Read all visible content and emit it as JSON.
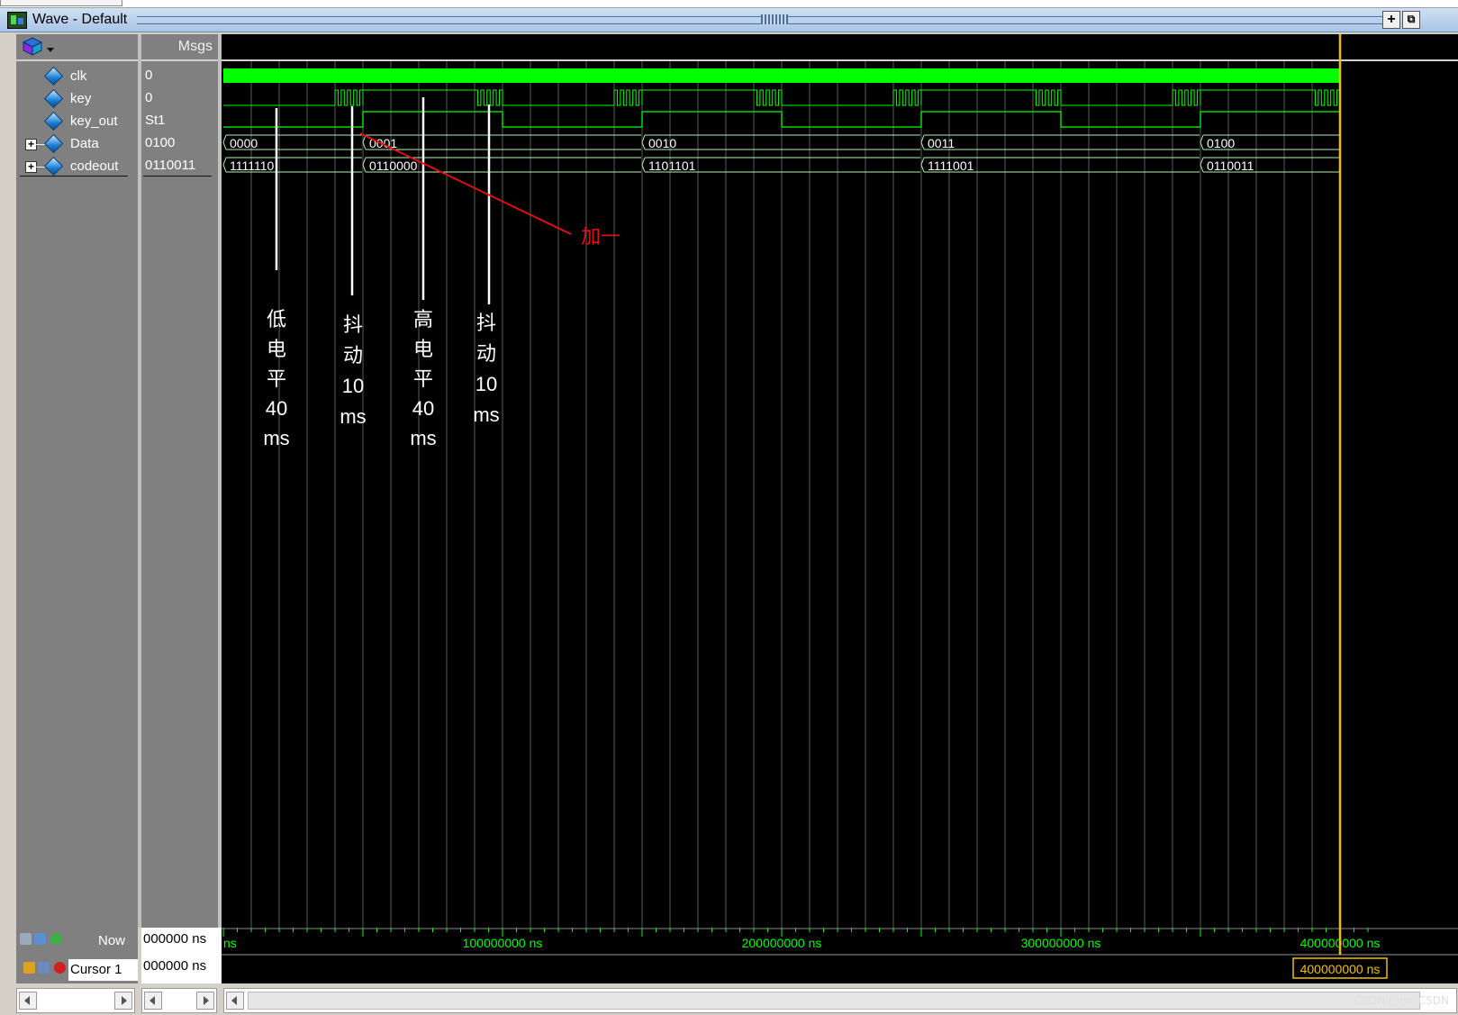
{
  "window": {
    "title": "Wave - Default",
    "add_button": "+",
    "undock_button": "⧉"
  },
  "names_pane": {
    "signals": [
      {
        "label": "clk",
        "expandable": false
      },
      {
        "label": "key",
        "expandable": false
      },
      {
        "label": "key_out",
        "expandable": false
      },
      {
        "label": "Data",
        "expandable": true
      },
      {
        "label": "codeout",
        "expandable": true
      }
    ],
    "expand_glyph": "+"
  },
  "values_pane": {
    "header": "Msgs",
    "values": [
      "0",
      "0",
      "St1",
      "0100",
      "0110011"
    ]
  },
  "waveform": {
    "data_bus": [
      {
        "value": "0000",
        "from_t": 0,
        "to_t": 50000000
      },
      {
        "value": "0001",
        "from_t": 50000000,
        "to_t": 150000000
      },
      {
        "value": "0010",
        "from_t": 150000000,
        "to_t": 250000000
      },
      {
        "value": "0011",
        "from_t": 250000000,
        "to_t": 350000000
      },
      {
        "value": "0100",
        "from_t": 350000000,
        "to_t": 400000000
      }
    ],
    "codeout_bus": [
      {
        "value": "1111110",
        "from_t": 0,
        "to_t": 50000000
      },
      {
        "value": "0110000",
        "from_t": 50000000,
        "to_t": 150000000
      },
      {
        "value": "1101101",
        "from_t": 150000000,
        "to_t": 250000000
      },
      {
        "value": "1111001",
        "from_t": 250000000,
        "to_t": 350000000
      },
      {
        "value": "0110011",
        "from_t": 350000000,
        "to_t": 400000000
      }
    ],
    "key_out_rise_t": [
      50000000,
      150000000,
      250000000,
      350000000
    ],
    "key_out_fall_t": [
      100000000,
      200000000,
      300000000,
      400000000
    ],
    "key_bounce_start_t": [
      40000000,
      90000000,
      140000000,
      190000000,
      240000000,
      290000000,
      340000000,
      390000000
    ],
    "key_bounce_duration_t": 10000000,
    "time_end": 400000000,
    "cursor_t": 400000000,
    "colors": {
      "signal": "#00ff00",
      "bus": "#b8f0b8",
      "cursor": "#f0c000",
      "annotation": "#ffffff",
      "arrow": "#e01010"
    }
  },
  "annotations": {
    "low_level": [
      "低",
      "电",
      "平",
      "40",
      "ms"
    ],
    "bounce1": [
      "抖",
      "动",
      "10",
      "ms"
    ],
    "high_level": [
      "高",
      "电",
      "平",
      "40",
      "ms"
    ],
    "bounce2": [
      "抖",
      "动",
      "10",
      "ms"
    ],
    "plus_one": "加一"
  },
  "timeline": {
    "left_fragment": "ns",
    "ticks": [
      {
        "t": 100000000,
        "label": "100000000 ns"
      },
      {
        "t": 200000000,
        "label": "200000000 ns"
      },
      {
        "t": 300000000,
        "label": "300000000 ns"
      },
      {
        "t": 400000000,
        "label": "400000000 ns"
      }
    ],
    "cursor_label": "400000000 ns"
  },
  "status": {
    "now_label": "Now",
    "now_value": "000000 ns",
    "cursor_label": "Cursor 1",
    "cursor_value": "000000 ns"
  },
  "watermark": "CSDN @gwlCSDN"
}
